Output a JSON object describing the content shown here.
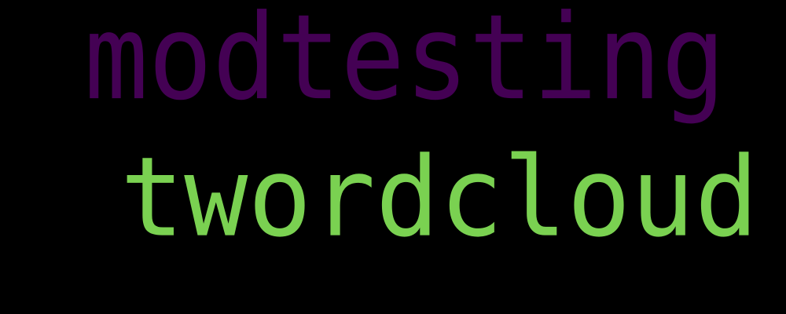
{
  "background": "#000000",
  "words": [
    {
      "text": "modtesting",
      "color": "#440154"
    },
    {
      "text": "twordcloud",
      "color": "#7ad151"
    }
  ]
}
